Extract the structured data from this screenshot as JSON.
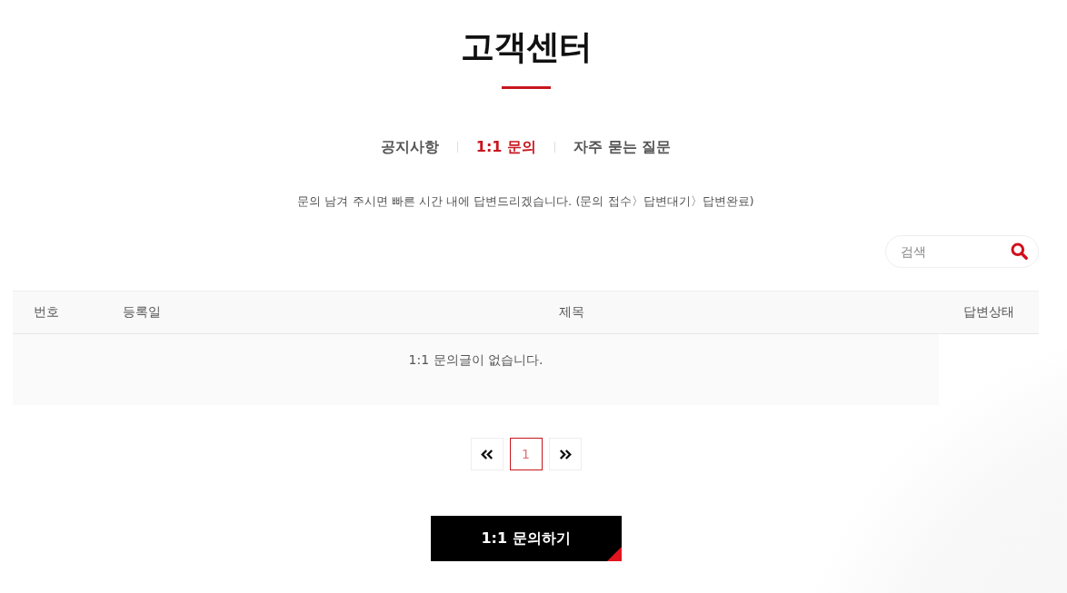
{
  "page": {
    "title": "고객센터"
  },
  "tabs": [
    {
      "label": "공지사항",
      "selected": false
    },
    {
      "label": "1:1 문의",
      "selected": true
    },
    {
      "label": "자주 묻는 질문",
      "selected": false
    }
  ],
  "notice": "문의 남겨 주시면 빠른 시간 내에 답변드리겠습니다. (문의 접수〉답변대기〉답변완료)",
  "search": {
    "placeholder": "검색"
  },
  "table": {
    "columns": [
      "번호",
      "등록일",
      "제목",
      "답변상태"
    ],
    "empty_message": "1:1 문의글이 없습니다."
  },
  "pagination": {
    "pages": [
      {
        "label": "1",
        "selected": true
      }
    ]
  },
  "write_button": "1:1 문의하기"
}
